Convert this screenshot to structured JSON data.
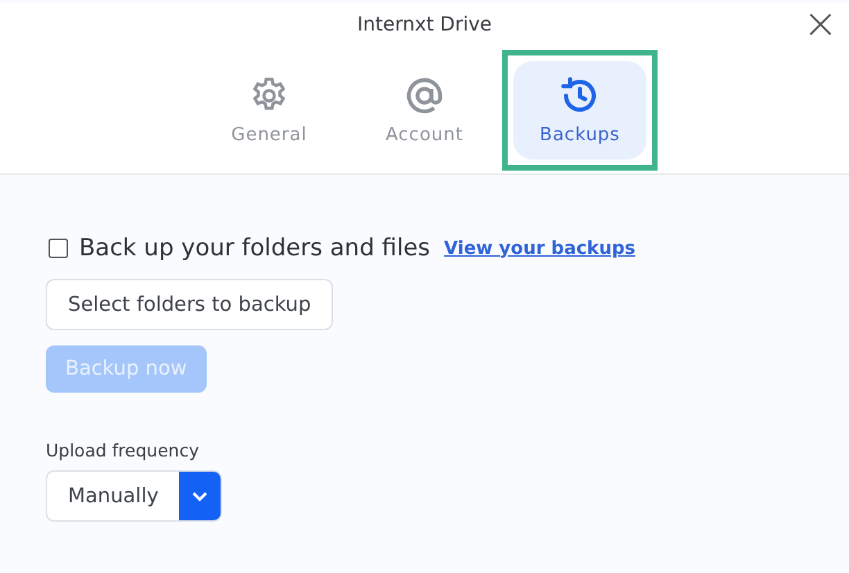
{
  "window": {
    "title": "Internxt Drive",
    "close": "×"
  },
  "tabs": [
    {
      "label": "General",
      "kind": "gear",
      "selected": false,
      "highlighted": false
    },
    {
      "label": "Account",
      "kind": "at",
      "selected": false,
      "highlighted": false
    },
    {
      "label": "Backups",
      "kind": "history",
      "selected": true,
      "highlighted": true
    }
  ],
  "backup": {
    "checkbox": {
      "label": "Back up your folders and files",
      "checked": false
    },
    "link": "View your backups",
    "buttons": [
      {
        "label": "Select folders to backup",
        "disabled": false,
        "kind": "secondary"
      },
      {
        "label": "Backup now",
        "disabled": true,
        "kind": "primary"
      }
    ],
    "frequency": {
      "label": "Upload frequency",
      "value": "Manually"
    }
  }
}
